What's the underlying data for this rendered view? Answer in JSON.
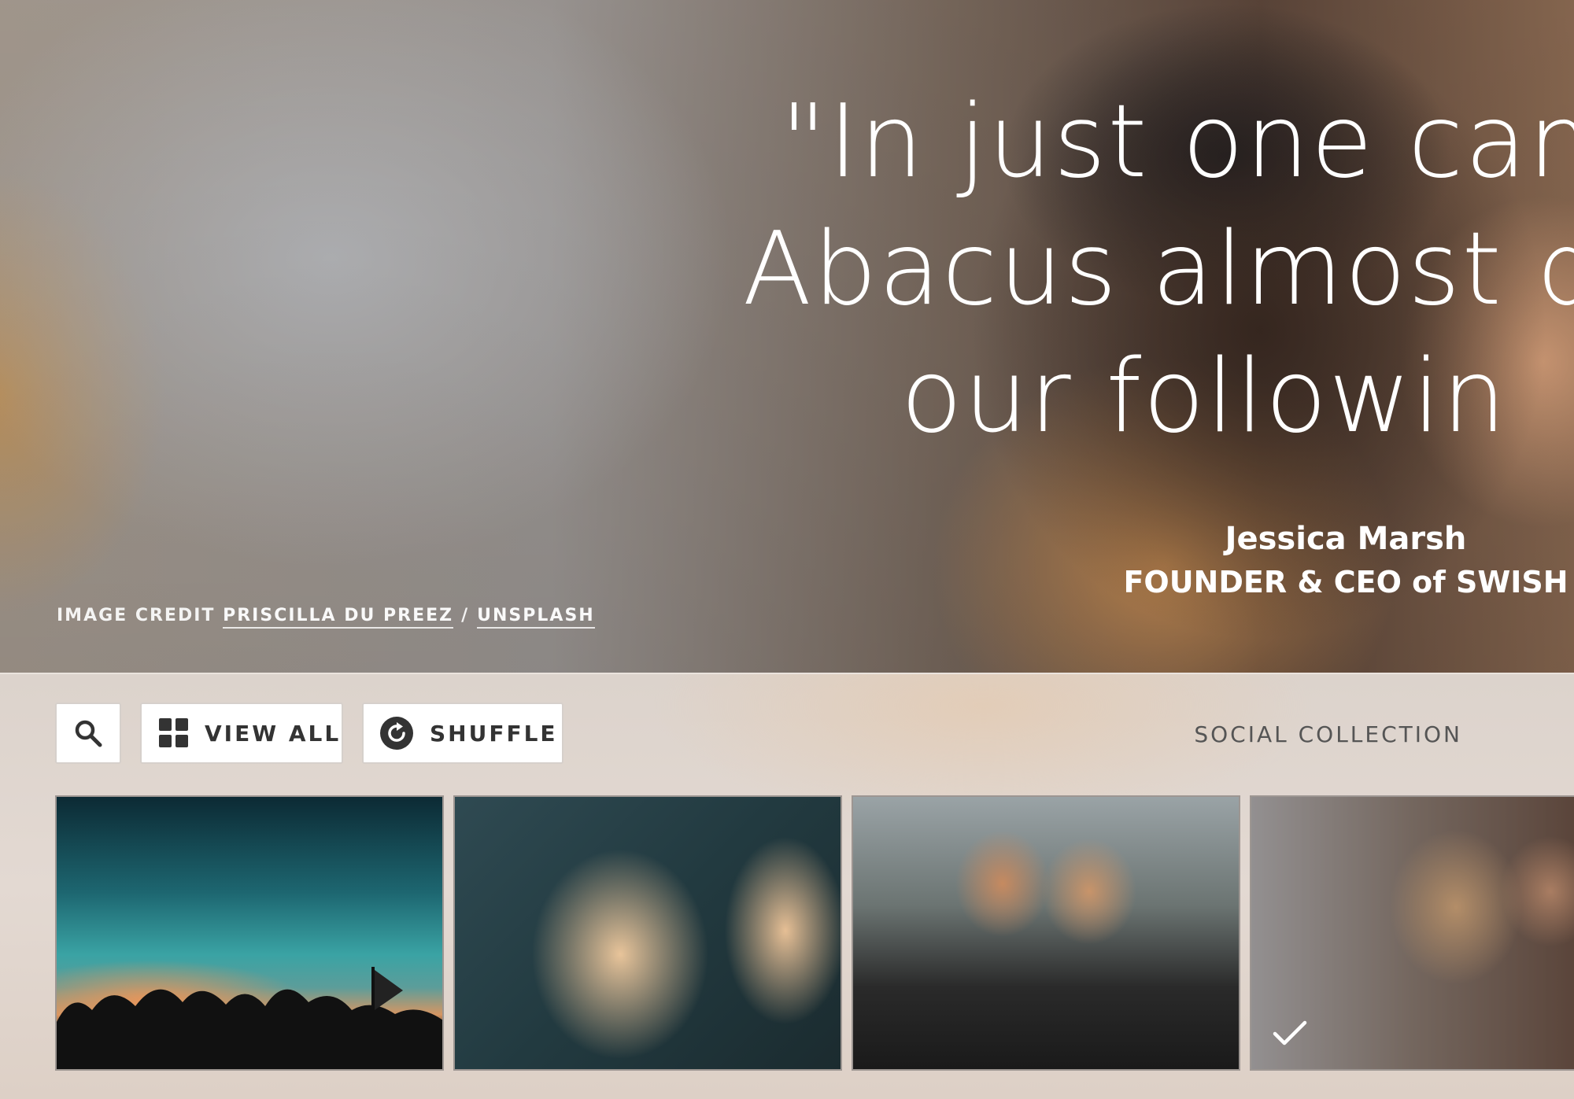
{
  "hero": {
    "quote": "\"In just one cam\nAbacus almost de\nour followin",
    "author_name": "Jessica Marsh",
    "author_title": "FOUNDER & CEO of SWISH",
    "credit": {
      "prefix": "IMAGE CREDIT",
      "photographer": "PRISCILLA DU PREEZ",
      "separator": "/",
      "source": "UNSPLASH"
    }
  },
  "toolbar": {
    "search_icon": "search-icon",
    "view_all_label": "VIEW ALL",
    "view_all_icon": "grid-icon",
    "shuffle_label": "SHUFFLE",
    "shuffle_icon": "shuffle-icon",
    "collection_label": "SOCIAL COLLECTION"
  },
  "thumbnails": [
    {
      "subject": "crowd silhouettes at dusk",
      "selected": false
    },
    {
      "subject": "two women laughing",
      "selected": false
    },
    {
      "subject": "two friends in blankets",
      "selected": false
    },
    {
      "subject": "group of friends (current hero image)",
      "selected": true
    }
  ],
  "colors": {
    "text_on_hero": "#ffffff",
    "button_bg": "#ffffff",
    "button_text": "#333333",
    "panel_bg": "#e0d6ce"
  }
}
